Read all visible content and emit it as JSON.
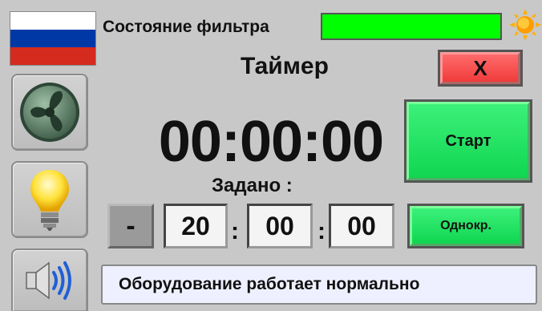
{
  "language": {
    "flag": [
      "#ffffff",
      "#0039a6",
      "#d52b1e"
    ],
    "icon": "russian-flag"
  },
  "sidebar": {
    "buttons": [
      {
        "name": "fan",
        "icon": "fan-icon"
      },
      {
        "name": "light",
        "icon": "light-bulb-icon"
      },
      {
        "name": "sound",
        "icon": "speaker-icon"
      }
    ]
  },
  "filter": {
    "label": "Состояние фильтра",
    "indicator_color": "#00ff00",
    "status_icon": "sun-icon"
  },
  "timer": {
    "title": "Таймер",
    "close_label": "X",
    "display": "00:00:00",
    "set_label": "Задано :",
    "set_hours": "20",
    "set_minutes": "00",
    "set_seconds": "00",
    "minus_label": "-",
    "colon": ":",
    "start_label": "Старт",
    "mode_label": "Однокр."
  },
  "status_message": "Оборудование работает нормально",
  "colors": {
    "background": "#c8c8c8",
    "button_green": "#00e050",
    "button_red": "#ff4b4b",
    "status_bg": "#eef0ff"
  }
}
